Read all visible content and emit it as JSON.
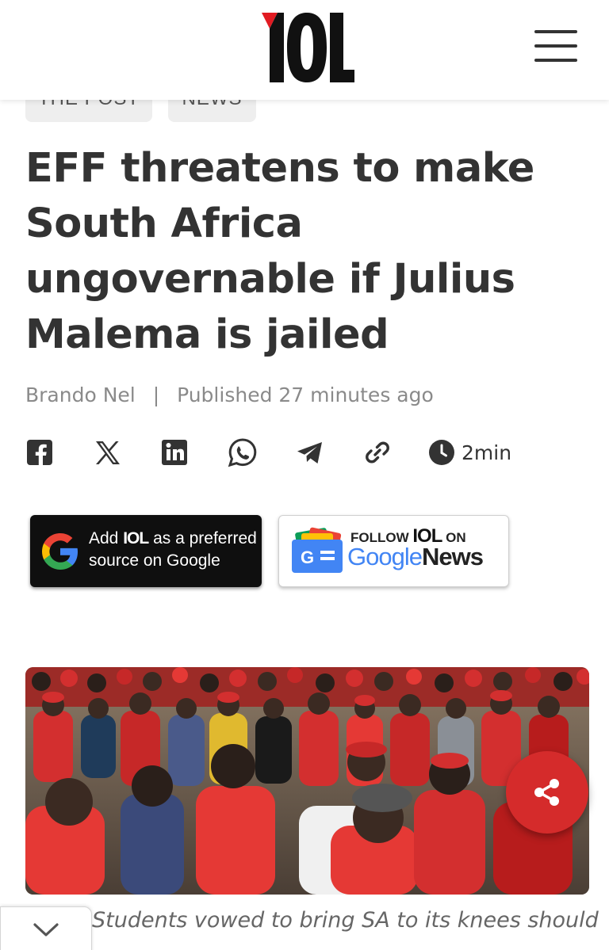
{
  "header": {
    "logo_text": "IOL",
    "menu_icon": "hamburger-menu-icon"
  },
  "breadcrumbs": [
    "THE POST",
    "NEWS"
  ],
  "article": {
    "headline": "EFF threatens to make South Africa ungovernable if Julius Malema is jailed",
    "author": "Brando Nel",
    "separator": "|",
    "published": "Published 27 minutes ago",
    "read_time": "2min",
    "caption": "Students vowed to bring SA to its knees should"
  },
  "share_icons": [
    "facebook-icon",
    "x-icon",
    "linkedin-icon",
    "whatsapp-icon",
    "telegram-icon",
    "copy-link-icon",
    "clock-icon"
  ],
  "promos": {
    "google_preferred": {
      "word_add": "Add",
      "brand": "IOL",
      "after_brand": "as a preferred",
      "line2": "source on Google"
    },
    "google_news": {
      "follow": "FOLLOW",
      "brand": "IOL",
      "on": "ON",
      "google": "Google",
      "news": "News"
    }
  },
  "colors": {
    "brand_red": "#e11b22",
    "fab_red": "#d52b2b",
    "text_dark": "#333333",
    "text_muted": "#8a8a8a"
  }
}
